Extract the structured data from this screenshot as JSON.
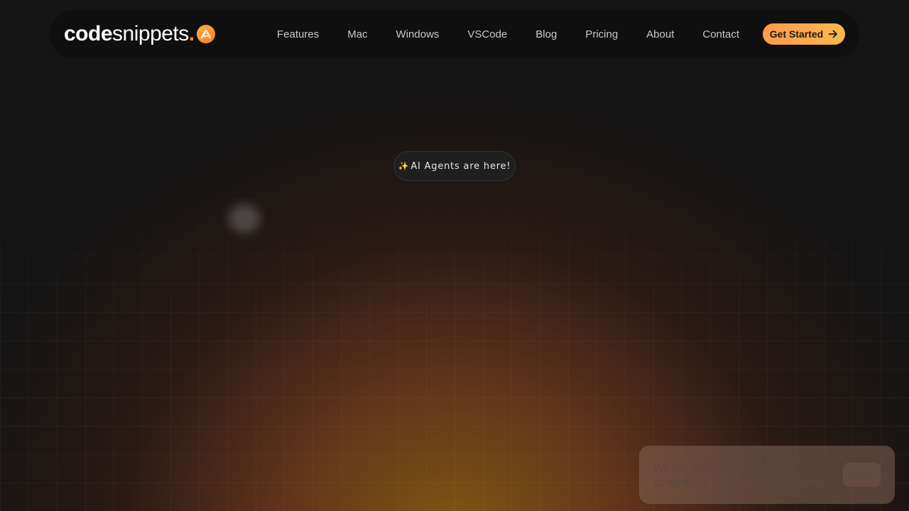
{
  "brand": {
    "name_bold": "code",
    "name_light": "snippets",
    "name_dot": ".",
    "badge_icon": "caret-up-icon",
    "accent": "#ff8a3d"
  },
  "nav": {
    "links": [
      {
        "label": "Features"
      },
      {
        "label": "Mac"
      },
      {
        "label": "Windows"
      },
      {
        "label": "VSCode"
      },
      {
        "label": "Blog"
      },
      {
        "label": "Pricing"
      },
      {
        "label": "About"
      },
      {
        "label": "Contact"
      }
    ],
    "cta_label": "Get Started",
    "cta_icon": "arrow-right-icon"
  },
  "hero": {
    "announcement": "AI Agents are here!",
    "announcement_icon": "sparkles-icon"
  },
  "cookie": {
    "message": "We use cookies to personalize content, run ads, and analyze traffic.",
    "accept_label": "Okay"
  }
}
